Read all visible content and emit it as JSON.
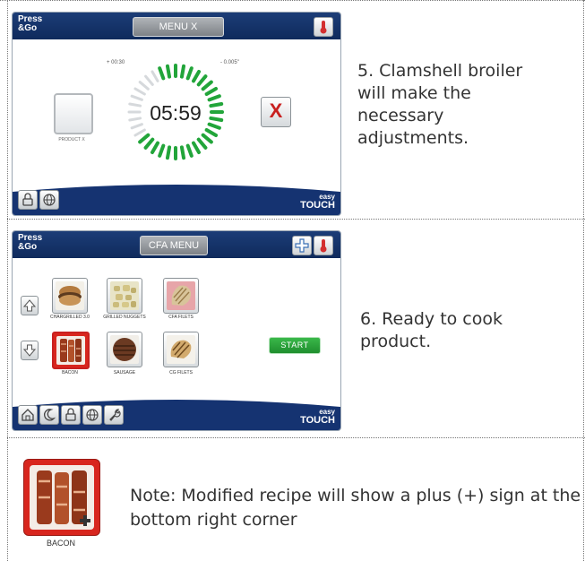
{
  "section1": {
    "brand_line1": "Press",
    "brand_line2": "&Go",
    "menu_title": "MENU X",
    "timer_left_label": "+ 00:30",
    "timer_right_label": "- 0.005\"",
    "timer_value": "05:59",
    "product_label": "PRODUCT X",
    "cancel_symbol": "X",
    "easy_line1": "easy",
    "easy_line2": "TOUCH",
    "step_text": "5.  Clamshell broiler will make the necessary adjustments."
  },
  "section2": {
    "brand_line1": "Press",
    "brand_line2": "&Go",
    "menu_title": "CFA MENU",
    "products": [
      {
        "label": "CHARGRILLED 3.0"
      },
      {
        "label": "GRILLED NUGGETS"
      },
      {
        "label": "CFA FILETS"
      },
      {
        "label": "BACON"
      },
      {
        "label": "SAUSAGE"
      },
      {
        "label": "CG FILETS"
      }
    ],
    "start_label": "START",
    "easy_line1": "easy",
    "easy_line2": "TOUCH",
    "step_text": "6.  Ready to cook product."
  },
  "section3": {
    "tile_label": "BACON",
    "note_text": "Note: Modified recipe will show a plus (+) sign at the bottom right corner"
  },
  "colors": {
    "header_blue": "#153371",
    "timer_green": "#22a53a",
    "cancel_red": "#c8201f",
    "start_green": "#2fa83f"
  }
}
